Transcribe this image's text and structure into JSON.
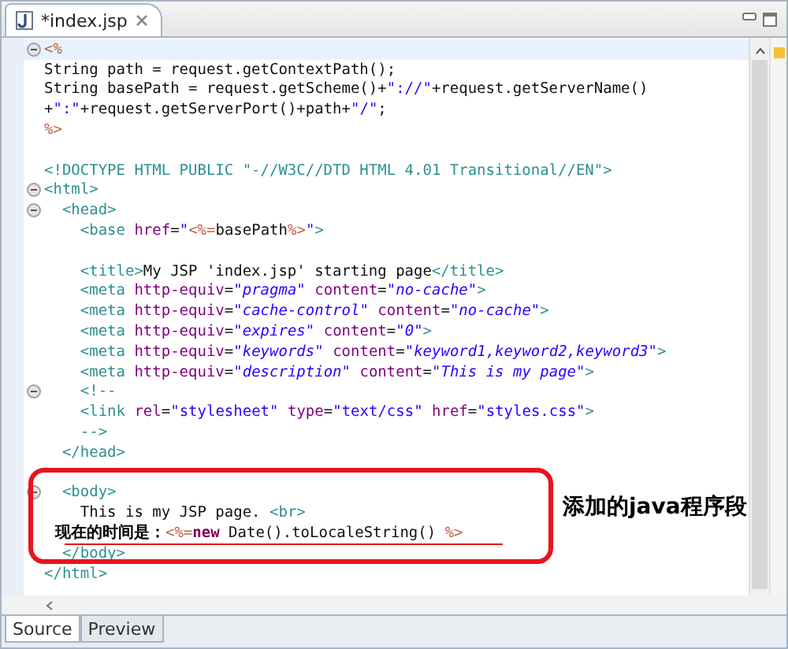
{
  "editor_tab": {
    "title": "*index.jsp",
    "selected": true
  },
  "lines": [
    {
      "fold": true,
      "current": true,
      "segments": [
        {
          "kind": "jsp",
          "text": "<%"
        }
      ]
    },
    {
      "fold": false,
      "current": false,
      "segments": [
        {
          "kind": "plain",
          "text": "String path = request.getContextPath();"
        }
      ]
    },
    {
      "fold": false,
      "current": false,
      "segments": [
        {
          "kind": "plain",
          "text": "String basePath = request.getScheme()+"
        },
        {
          "kind": "string",
          "text": "\"://\""
        },
        {
          "kind": "plain",
          "text": "+request.getServerName()"
        }
      ]
    },
    {
      "fold": false,
      "current": false,
      "segments": [
        {
          "kind": "plain",
          "text": "+"
        },
        {
          "kind": "string",
          "text": "\":\""
        },
        {
          "kind": "plain",
          "text": "+request.getServerPort()+path+"
        },
        {
          "kind": "string",
          "text": "\"/\""
        },
        {
          "kind": "plain",
          "text": ";"
        }
      ]
    },
    {
      "fold": false,
      "current": false,
      "segments": [
        {
          "kind": "jsp",
          "text": "%>"
        }
      ]
    },
    {
      "fold": false,
      "current": false
    },
    {
      "fold": false,
      "current": false,
      "segments": [
        {
          "kind": "tag",
          "text": "<!DOCTYPE HTML PUBLIC \"-//W3C//DTD HTML 4.01 Transitional//EN\">"
        }
      ]
    },
    {
      "fold": true,
      "current": false,
      "segments": [
        {
          "kind": "tag",
          "text": "<html>"
        }
      ]
    },
    {
      "fold": true,
      "current": false,
      "segments": [
        {
          "kind": "tag",
          "text": "  <head>"
        }
      ]
    },
    {
      "fold": false,
      "current": false,
      "segments": [
        {
          "kind": "tag",
          "text": "    <base "
        },
        {
          "kind": "attr",
          "text": "href"
        },
        {
          "kind": "plain",
          "text": "="
        },
        {
          "kind": "string",
          "text": "\""
        },
        {
          "kind": "jsp",
          "text": "<%="
        },
        {
          "kind": "plain",
          "text": "basePath"
        },
        {
          "kind": "jsp",
          "text": "%>"
        },
        {
          "kind": "string",
          "text": "\""
        },
        {
          "kind": "tag",
          "text": ">"
        }
      ]
    },
    {
      "fold": false,
      "current": false
    },
    {
      "fold": false,
      "current": false,
      "segments": [
        {
          "kind": "tag",
          "text": "    <title>"
        },
        {
          "kind": "plain",
          "text": "My JSP 'index.jsp' starting page"
        },
        {
          "kind": "tag",
          "text": "</title>"
        }
      ]
    },
    {
      "fold": false,
      "current": false,
      "segments": [
        {
          "kind": "tag",
          "text": "    <meta "
        },
        {
          "kind": "attr",
          "text": "http-equiv"
        },
        {
          "kind": "plain",
          "text": "="
        },
        {
          "kind": "value",
          "text": "\"pragma\""
        },
        {
          "kind": "attr",
          "text": " content"
        },
        {
          "kind": "plain",
          "text": "="
        },
        {
          "kind": "value",
          "text": "\"no-cache\""
        },
        {
          "kind": "tag",
          "text": ">"
        }
      ]
    },
    {
      "fold": false,
      "current": false,
      "segments": [
        {
          "kind": "tag",
          "text": "    <meta "
        },
        {
          "kind": "attr",
          "text": "http-equiv"
        },
        {
          "kind": "plain",
          "text": "="
        },
        {
          "kind": "value",
          "text": "\"cache-control\""
        },
        {
          "kind": "attr",
          "text": " content"
        },
        {
          "kind": "plain",
          "text": "="
        },
        {
          "kind": "value",
          "text": "\"no-cache\""
        },
        {
          "kind": "tag",
          "text": ">"
        }
      ]
    },
    {
      "fold": false,
      "current": false,
      "segments": [
        {
          "kind": "tag",
          "text": "    <meta "
        },
        {
          "kind": "attr",
          "text": "http-equiv"
        },
        {
          "kind": "plain",
          "text": "="
        },
        {
          "kind": "value",
          "text": "\"expires\""
        },
        {
          "kind": "attr",
          "text": " content"
        },
        {
          "kind": "plain",
          "text": "="
        },
        {
          "kind": "value",
          "text": "\"0\""
        },
        {
          "kind": "tag",
          "text": ">"
        }
      ]
    },
    {
      "fold": false,
      "current": false,
      "segments": [
        {
          "kind": "tag",
          "text": "    <meta "
        },
        {
          "kind": "attr",
          "text": "http-equiv"
        },
        {
          "kind": "plain",
          "text": "="
        },
        {
          "kind": "value",
          "text": "\"keywords\""
        },
        {
          "kind": "attr",
          "text": " content"
        },
        {
          "kind": "plain",
          "text": "="
        },
        {
          "kind": "value",
          "text": "\"keyword1,keyword2,keyword3\""
        },
        {
          "kind": "tag",
          "text": ">"
        }
      ]
    },
    {
      "fold": false,
      "current": false,
      "segments": [
        {
          "kind": "tag",
          "text": "    <meta "
        },
        {
          "kind": "attr",
          "text": "http-equiv"
        },
        {
          "kind": "plain",
          "text": "="
        },
        {
          "kind": "value",
          "text": "\"description\""
        },
        {
          "kind": "attr",
          "text": " content"
        },
        {
          "kind": "plain",
          "text": "="
        },
        {
          "kind": "value",
          "text": "\"This is my page\""
        },
        {
          "kind": "tag",
          "text": ">"
        }
      ]
    },
    {
      "fold": true,
      "current": false,
      "segments": [
        {
          "kind": "tag",
          "text": "    <!--"
        }
      ]
    },
    {
      "fold": false,
      "current": false,
      "segments": [
        {
          "kind": "tag",
          "text": "    <link "
        },
        {
          "kind": "attr",
          "text": "rel"
        },
        {
          "kind": "plain",
          "text": "="
        },
        {
          "kind": "string",
          "text": "\"stylesheet\""
        },
        {
          "kind": "attr",
          "text": " type"
        },
        {
          "kind": "plain",
          "text": "="
        },
        {
          "kind": "string",
          "text": "\"text/css\""
        },
        {
          "kind": "attr",
          "text": " href"
        },
        {
          "kind": "plain",
          "text": "="
        },
        {
          "kind": "string",
          "text": "\"styles.css\""
        },
        {
          "kind": "tag",
          "text": ">"
        }
      ]
    },
    {
      "fold": false,
      "current": false,
      "segments": [
        {
          "kind": "tag",
          "text": "    -->"
        }
      ]
    },
    {
      "fold": false,
      "current": false,
      "segments": [
        {
          "kind": "tag",
          "text": "  </head>"
        }
      ]
    },
    {
      "fold": false,
      "current": false
    },
    {
      "fold": true,
      "current": false,
      "segments": [
        {
          "kind": "tag",
          "text": "  <body>"
        }
      ]
    },
    {
      "fold": false,
      "current": false,
      "segments": [
        {
          "kind": "plain",
          "text": "    This is my JSP page. "
        },
        {
          "kind": "tag",
          "text": "<br>"
        }
      ]
    },
    {
      "fold": false,
      "current": false,
      "segments": [
        {
          "kind": "cjk",
          "text": "  现在的时间是："
        },
        {
          "kind": "jsp",
          "text": "<%="
        },
        {
          "kind": "keyword",
          "text": "new"
        },
        {
          "kind": "plain",
          "text": " Date().toLocaleString() "
        },
        {
          "kind": "jsp",
          "text": "%>"
        }
      ]
    },
    {
      "fold": false,
      "current": false,
      "segments": [
        {
          "kind": "tag",
          "text": "  </body>"
        }
      ]
    },
    {
      "fold": false,
      "current": false,
      "segments": [
        {
          "kind": "tag",
          "text": "</html>"
        }
      ]
    }
  ],
  "annotation": {
    "label": "添加的java程序段"
  },
  "bottom_tabs": [
    {
      "label": "Source",
      "selected": true
    },
    {
      "label": "Preview",
      "selected": false
    }
  ]
}
